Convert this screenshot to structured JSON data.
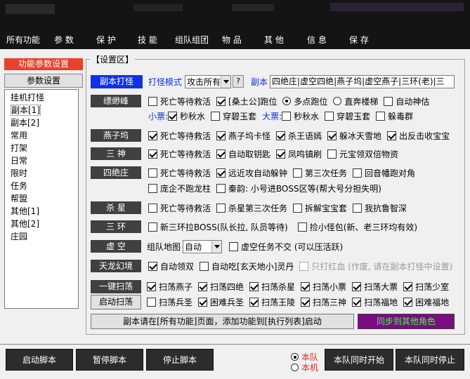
{
  "menu": {
    "items": [
      "所有功能",
      "参 数",
      "保 护",
      "技 能",
      "组队组团",
      "物 品",
      "其 他",
      "信 息",
      "保 存"
    ],
    "active_index": 1
  },
  "left": {
    "title": "功能参数设置",
    "button": "参数设置",
    "list": [
      "挂机打怪",
      "副本[1]",
      "副本[2]",
      "常用",
      "打架",
      "日常",
      "限时",
      "任务",
      "帮盟",
      "其他[1]",
      "其他[2]",
      "庄园"
    ],
    "selected_index": 1
  },
  "settings": {
    "group_title": "【设置区】",
    "dungeon_label": "副本打怪",
    "mode_label": "打怪模式",
    "mode_value": "攻击所有",
    "help_btn": "?",
    "dungeon_text_label": "副本",
    "dungeon_text_value": "四绝庄|虚空四绝|燕子坞|虚空燕子|三环(老)|三",
    "piaomiao": {
      "label": "缥缈峰",
      "opts": [
        {
          "text": "死亡等待救活",
          "checked": false
        },
        {
          "text": "[桑土公]跑位",
          "checked": true
        }
      ],
      "radios": [
        {
          "text": "多点跑位",
          "checked": true
        },
        {
          "text": "直奔楼梯",
          "checked": false
        }
      ],
      "extra": {
        "text": "自动神估",
        "checked": false
      },
      "small_label": "小票:",
      "small": [
        {
          "text": "秒秋水",
          "checked": true
        },
        {
          "text": "穿碧玉套",
          "checked": false
        }
      ],
      "big_label": "大票:",
      "big": [
        {
          "text": "秒秋水",
          "checked": false
        },
        {
          "text": "穿碧玉套",
          "checked": false
        },
        {
          "text": "躲毒群",
          "checked": false
        }
      ]
    },
    "yanziwu": {
      "label": "燕子坞",
      "opts": [
        {
          "text": "死亡等待救活",
          "checked": true
        },
        {
          "text": "燕子坞卡怪",
          "checked": true
        },
        {
          "text": "杀王语嫣",
          "checked": true
        },
        {
          "text": "躲冰天雪地",
          "checked": true
        },
        {
          "text": "出反击收宝宝",
          "checked": true
        }
      ]
    },
    "sanshen": {
      "label": "三 神",
      "opts": [
        {
          "text": "死亡等待救活",
          "checked": true
        },
        {
          "text": "自动取钥匙",
          "checked": true
        },
        {
          "text": "凤鸣镇刷",
          "checked": true
        },
        {
          "text": "元宝领双倍物资",
          "checked": false
        }
      ]
    },
    "sijue": {
      "label": "四绝庄",
      "row1": [
        {
          "text": "死亡等待救活",
          "checked": false
        },
        {
          "text": "远近攻自动躲钟",
          "checked": true
        },
        {
          "text": "第三次任务",
          "checked": false
        },
        {
          "text": "回音幡跑对角",
          "checked": false
        }
      ],
      "row2": [
        {
          "text": "庞企不跑龙柱",
          "checked": false
        },
        {
          "text": "秦韵: 小号进BOSS区等(帮大号分担失明)",
          "checked": false
        }
      ]
    },
    "shaxing": {
      "label": "杀 星",
      "opts": [
        {
          "text": "死亡等待救活",
          "checked": false
        },
        {
          "text": "杀星第三次任务",
          "checked": false
        },
        {
          "text": "拆解宝宝套",
          "checked": false
        },
        {
          "text": "我抗鲁智深",
          "checked": false
        }
      ]
    },
    "sanhuan": {
      "label": "三 环",
      "opts": [
        {
          "text": "新三环拉BOSS(队长拉, 队员等待)",
          "checked": false
        },
        {
          "text": "捡小怪包(新、老三环均有效)",
          "checked": false
        }
      ]
    },
    "xukong": {
      "label": "虚 空",
      "map_label": "组队地图",
      "map_value": "自动",
      "opt": {
        "text": "虚空任务不交 (可以压活跃)",
        "checked": false
      }
    },
    "tianlong": {
      "label": "天龙幻境",
      "opts": [
        {
          "text": "自动领双",
          "checked": true
        },
        {
          "text": "自动吃[玄天地小]灵丹",
          "checked": false
        },
        {
          "text": "只打红血 (作废, 请在副本打怪中设置)",
          "checked": false,
          "disabled": true
        }
      ]
    },
    "sweep": {
      "label": "一键扫荡",
      "start_btn": "启动扫荡",
      "row1": [
        {
          "text": "扫荡燕子",
          "checked": true
        },
        {
          "text": "扫荡四绝",
          "checked": true
        },
        {
          "text": "扫荡杀星",
          "checked": true
        },
        {
          "text": "扫荡小票",
          "checked": true
        },
        {
          "text": "扫荡大票",
          "checked": true
        },
        {
          "text": "扫荡少室",
          "checked": true
        }
      ],
      "row2": [
        {
          "text": "扫荡兵圣",
          "checked": false
        },
        {
          "text": "困难兵圣",
          "checked": true
        },
        {
          "text": "扫荡王陵",
          "checked": true
        },
        {
          "text": "扫荡三神",
          "checked": true
        },
        {
          "text": "扫荡福地",
          "checked": true
        },
        {
          "text": "困难福地",
          "checked": true
        }
      ]
    },
    "notice_btn": "副本请在[所有功能]页面，添加功能到[执行列表]启动",
    "sync_btn": "同步到其他角色",
    "sync_color": "#7a0d82"
  },
  "footer": {
    "start": "启动脚本",
    "pause": "暂停脚本",
    "stop": "停止脚本",
    "radio_team": "本队",
    "radio_machine": "本机",
    "team_start": "本队同时开始",
    "team_stop": "本队同时停止"
  },
  "colors": {
    "active_tab": "#d42a2a",
    "blue_label": "#1030e8",
    "left_title": "#e8412c"
  }
}
